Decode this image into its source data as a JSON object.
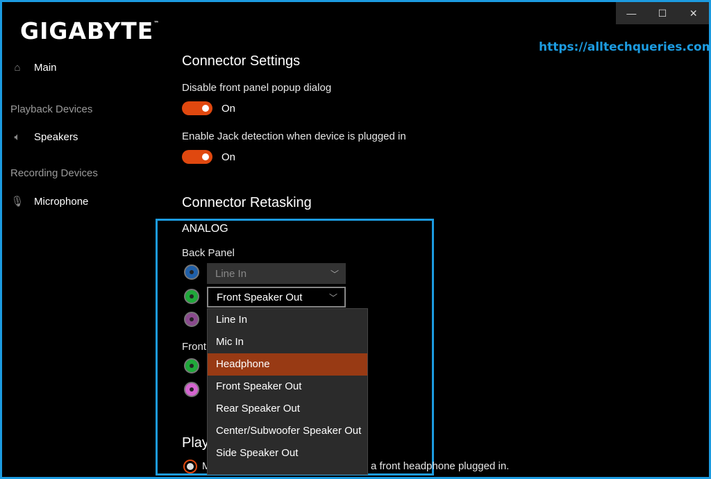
{
  "window": {
    "controls": {
      "minimize": "—",
      "maximize": "☐",
      "close": "✕"
    }
  },
  "brand": {
    "logo": "GIGABYTE",
    "trademark": "™"
  },
  "watermark": {
    "url": "https://alltechqueries.com/",
    "color": "#1c9be0"
  },
  "sidebar": {
    "main": {
      "label": "Main",
      "icon": "home-icon"
    },
    "playback_header": "Playback Devices",
    "speakers": {
      "label": "Speakers",
      "icon": "speaker-icon"
    },
    "recording_header": "Recording Devices",
    "microphone": {
      "label": "Microphone",
      "icon": "microphone-icon"
    }
  },
  "connector_settings": {
    "title": "Connector Settings",
    "disable_popup": {
      "label": "Disable front panel popup dialog",
      "state": "On"
    },
    "jack_detection": {
      "label": "Enable Jack detection when device is plugged in",
      "state": "On"
    }
  },
  "connector_retasking": {
    "title": "Connector Retasking",
    "analog_label": "ANALOG",
    "back_panel_label": "Back Panel",
    "front_panel_label": "Front",
    "back_jacks": [
      {
        "color": "#1f5fa8",
        "value": "Line In",
        "enabled": false
      },
      {
        "color": "#1fa83a",
        "value": "Front Speaker Out",
        "enabled": true
      },
      {
        "color": "#8a4a8e",
        "value": ""
      }
    ],
    "front_jacks": [
      {
        "color": "#1fa83a"
      },
      {
        "color": "#d465d0"
      }
    ],
    "dropdown_options": [
      "Line In",
      "Mic In",
      "Headphone",
      "Front Speaker Out",
      "Rear Speaker Out",
      "Center/Subwoofer Speaker Out",
      "Side Speaker Out"
    ],
    "highlighted_option": "Headphone"
  },
  "playback": {
    "title_partial": "Play",
    "radio_prefix": "M",
    "radio_suffix": "a front headphone plugged in."
  },
  "colors": {
    "accent": "#e0480f",
    "highlight": "#983a14",
    "frame": "#1c9be0"
  }
}
